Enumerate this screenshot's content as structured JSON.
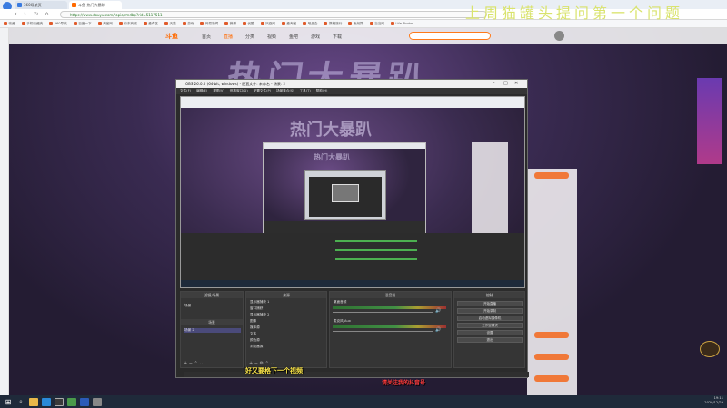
{
  "browser": {
    "tabs": [
      {
        "label": "360导航页",
        "favicon_color": "#3a7be0"
      },
      {
        "label": "斗鱼-热门大暴趴",
        "favicon_color": "#ff6a00"
      }
    ],
    "nav": {
      "back": "‹",
      "forward": "›",
      "reload": "↻",
      "home": "⌂"
    },
    "url": "https://www.douyu.com/topic/rmdbp?rid=5117511",
    "bookmarks": [
      "收藏",
      "手机收藏夹",
      "360导航",
      "百度一下",
      "淘宝网",
      "京东商城",
      "爱奇艺",
      "天猫",
      "游戏",
      "网易新闻",
      "微博",
      "优酷",
      "凤凰网",
      "爱淘宝",
      "唯品会",
      "携程旅行",
      "聚划算",
      "当当网",
      "Life Photos"
    ]
  },
  "watermark": "上周猫罐头提问第一个问题",
  "douyu": {
    "logo": "斗鱼",
    "nav": [
      "首页",
      "直播",
      "分类",
      "视频",
      "鱼吧",
      "游戏",
      "下载"
    ],
    "banner": "热门大暴趴",
    "accent": "#ff6a00"
  },
  "obs": {
    "title": "OBS 26.0.0 (64-bit, windows) - 配置文件: 未命名 - 场景: 2",
    "menu": [
      "文件(F)",
      "编辑(E)",
      "视图(V)",
      "停靠窗口(D)",
      "配置文件(P)",
      "场景集合(S)",
      "工具(T)",
      "帮助(H)"
    ],
    "preview_title": "热门大暴趴",
    "docks": {
      "filters": "滤镜/场景",
      "scenes": "场景",
      "sources": "来源",
      "mixer": "混音器",
      "transitions": "转场特效",
      "controls": "控制"
    },
    "scene_items": [
      "场景",
      "场景 2"
    ],
    "source_items": [
      "显示器捕获 1",
      "窗口捕获",
      "显示器捕获 2",
      "图像",
      "媒体源",
      "文本",
      "颜色源",
      "浏览器源"
    ],
    "mixer_channels": [
      "桌面音频",
      "麦克风/Aux"
    ],
    "controls": [
      "开始直播",
      "开始录制",
      "启动虚拟摄像机",
      "工作室模式",
      "设置",
      "退出"
    ]
  },
  "subtitles": {
    "line1": "好又要格下一个视频",
    "line2": "请关注我的抖音号"
  },
  "taskbar": {
    "icons": [
      "windows",
      "search",
      "file-explorer",
      "browser",
      "obs",
      "chrome",
      "word",
      "settings"
    ],
    "time": "19:11",
    "date": "2020/12/29"
  }
}
